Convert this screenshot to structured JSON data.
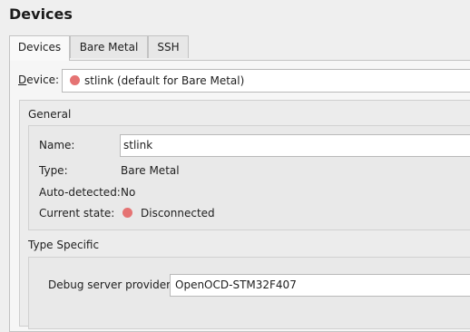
{
  "page_title": "Devices",
  "tabs": [
    {
      "label": "Devices",
      "active": true
    },
    {
      "label": "Bare Metal",
      "active": false
    },
    {
      "label": "SSH",
      "active": false
    }
  ],
  "device": {
    "label_prefix": "D",
    "label_rest": "evice:",
    "selected": "stlink (default for Bare Metal)",
    "status_color": "#e57373"
  },
  "general": {
    "title": "General",
    "name_label": "Name:",
    "name_value": "stlink",
    "type_label": "Type:",
    "type_value": "Bare Metal",
    "auto_label": "Auto-detected:",
    "auto_value": "No",
    "state_label": "Current state:",
    "state_value": "Disconnected",
    "state_color": "#e57373"
  },
  "type_specific": {
    "title": "Type Specific",
    "debug_label": "Debug server provider:",
    "debug_value": "OpenOCD-STM32F407"
  }
}
